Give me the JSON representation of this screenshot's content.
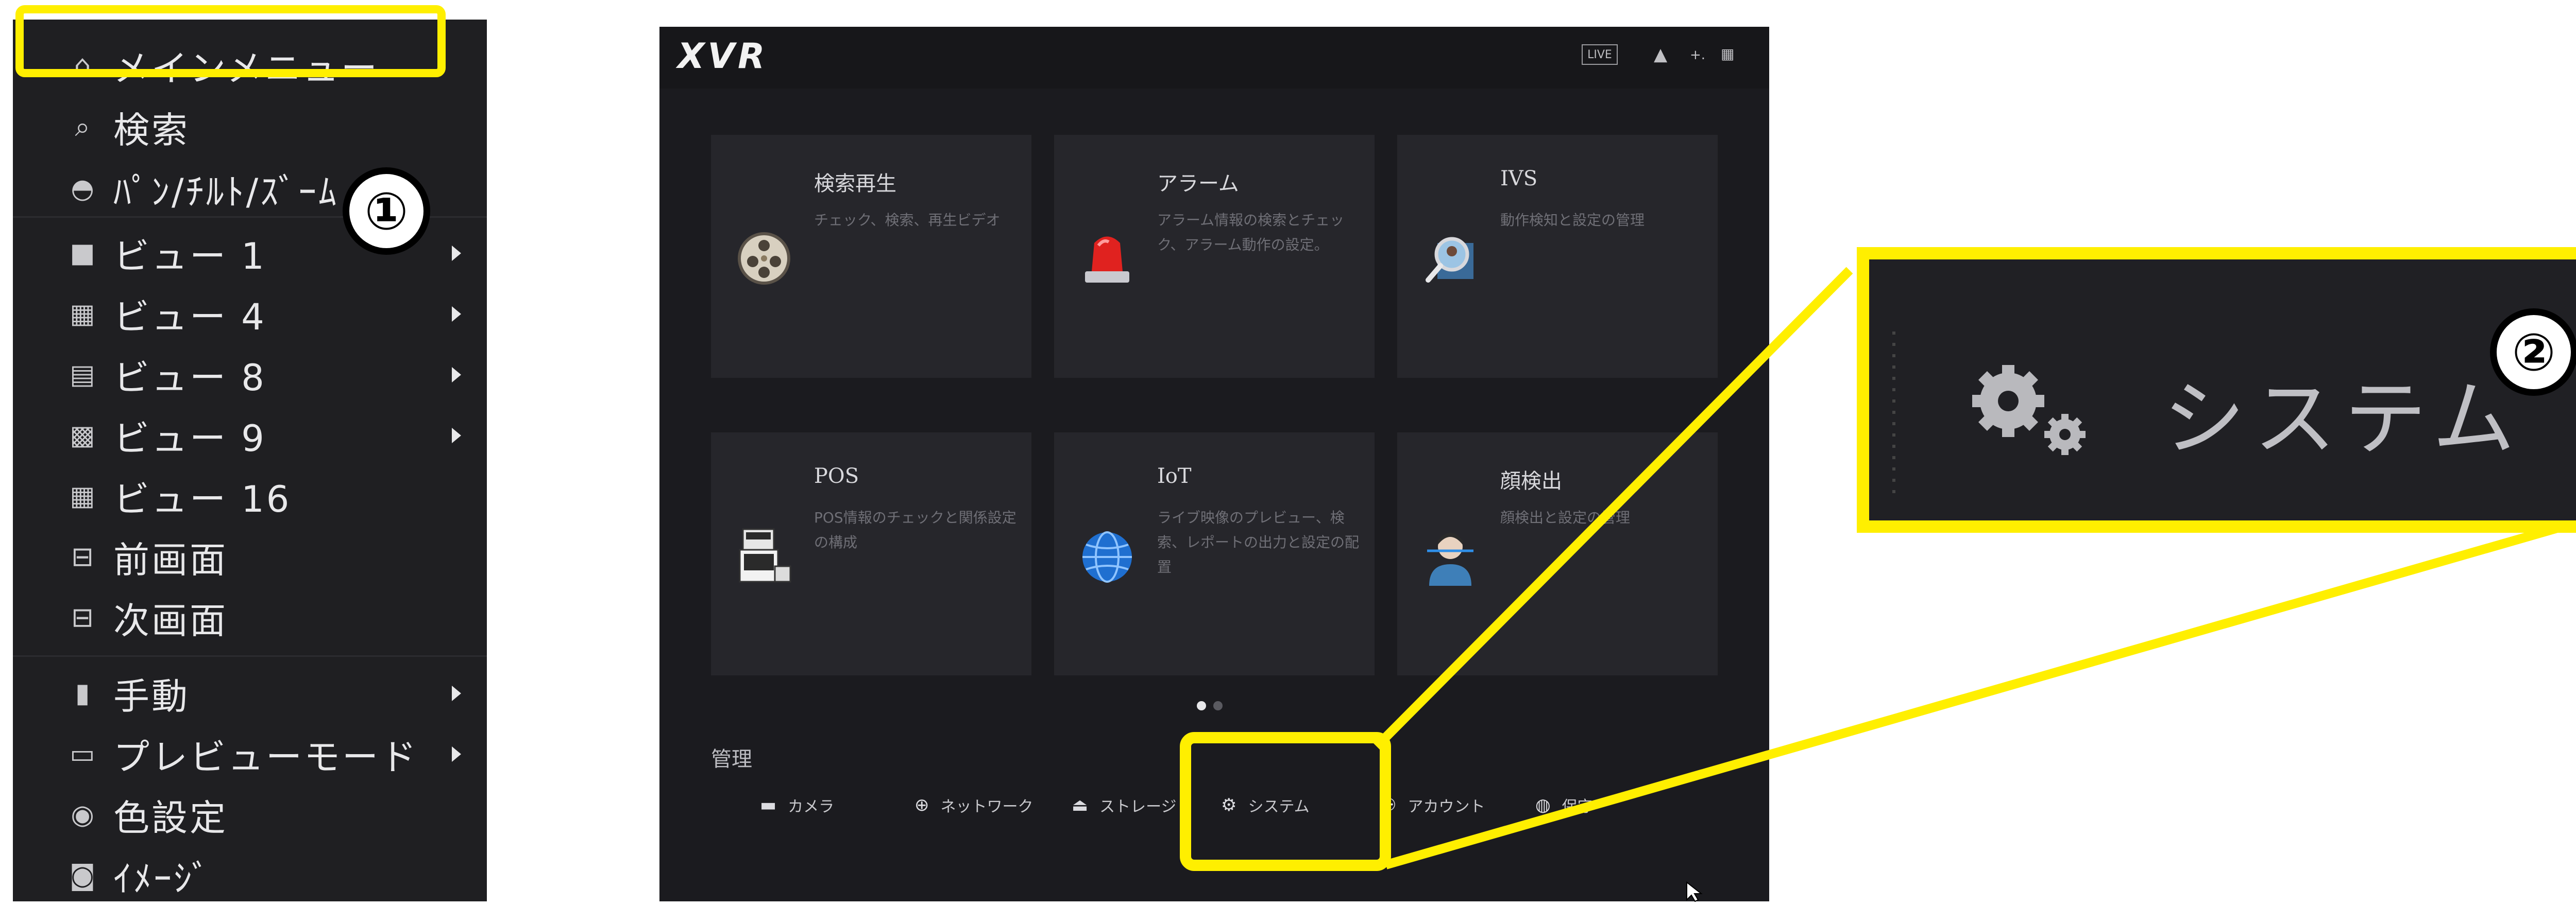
{
  "context_menu": {
    "items": [
      {
        "label": "メインメニュー",
        "icon": "home-icon",
        "glyph": "⌂"
      },
      {
        "label": "検索",
        "icon": "search-icon",
        "glyph": "⌕"
      },
      {
        "label": "ﾊﾟﾝ/ﾁﾙﾄ/ｽﾞｰﾑ",
        "icon": "ptz-camera-icon",
        "glyph": "◓"
      },
      {
        "label": "ビュー 1",
        "icon": "view-1-icon",
        "glyph": "■"
      },
      {
        "label": "ビュー 4",
        "icon": "view-4-icon",
        "glyph": "▦"
      },
      {
        "label": "ビュー 8",
        "icon": "view-8-icon",
        "glyph": "▤"
      },
      {
        "label": "ビュー 9",
        "icon": "view-9-icon",
        "glyph": "▩"
      },
      {
        "label": "ビュー 16",
        "icon": "view-16-icon",
        "glyph": "▦"
      },
      {
        "label": "前画面",
        "icon": "previous-screen-icon",
        "glyph": "⊟"
      },
      {
        "label": "次画面",
        "icon": "next-screen-icon",
        "glyph": "⊟"
      },
      {
        "label": "手動",
        "icon": "manual-icon",
        "glyph": "▮"
      },
      {
        "label": "プレビューモード",
        "icon": "preview-mode-icon",
        "glyph": "▭"
      },
      {
        "label": "色設定",
        "icon": "color-settings-icon",
        "glyph": "◉"
      },
      {
        "label": "ｲﾒｰｼﾞ",
        "icon": "image-camera-icon",
        "glyph": "◙"
      }
    ]
  },
  "step_markers": {
    "step1": "①",
    "step2": "②"
  },
  "main_screen": {
    "logo": "XVR",
    "live_button": "LIVE",
    "topbar_icons": [
      "user-icon",
      "shortcut-icon",
      "grid-menu-icon"
    ],
    "tiles": [
      {
        "title": "検索再生",
        "desc": "チェック、検索、再生ビデオ",
        "icon": "film-reel-icon"
      },
      {
        "title": "アラーム",
        "desc": "アラーム情報の検索とチェック、アラーム動作の設定。",
        "icon": "alarm-siren-icon"
      },
      {
        "title": "IVS",
        "desc": "動作検知と設定の管理",
        "icon": "magnifier-person-icon"
      },
      {
        "title": "POS",
        "desc": "POS情報のチェックと関係設定の構成",
        "icon": "pos-terminal-icon"
      },
      {
        "title": "IoT",
        "desc": "ライブ映像のプレビュー、検索、レポートの出力と設定の配置",
        "icon": "globe-icon"
      },
      {
        "title": "顔検出",
        "desc": "顔検出と設定の管理",
        "icon": "face-scan-icon"
      }
    ],
    "pagination": {
      "current": 1,
      "total": 2
    },
    "management": {
      "title": "管理",
      "items": [
        {
          "label": "カメラ",
          "icon": "camera-icon",
          "glyph": "▬"
        },
        {
          "label": "ネットワーク",
          "icon": "network-icon",
          "glyph": "⊕"
        },
        {
          "label": "ストレージ",
          "icon": "storage-icon",
          "glyph": "⏏"
        },
        {
          "label": "システム",
          "icon": "system-gears-icon",
          "glyph": "⚙"
        },
        {
          "label": "アカウント",
          "icon": "account-icon",
          "glyph": "⚇"
        },
        {
          "label": "保守",
          "icon": "maintenance-icon",
          "glyph": "◍"
        }
      ]
    }
  },
  "zoom_callout": {
    "label": "システム",
    "icon": "system-gears-icon"
  },
  "colors": {
    "highlight": "#ffef00",
    "menu_bg": "#1f1f22",
    "screen_bg": "#1b1b1f",
    "tile_bg": "#26262b"
  }
}
